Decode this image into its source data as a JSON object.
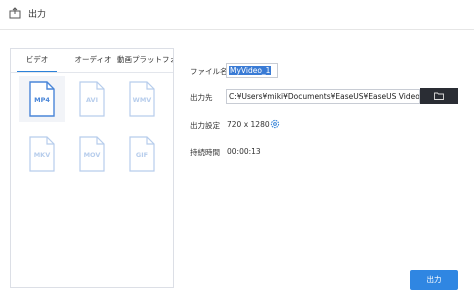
{
  "window": {
    "title": "出力"
  },
  "tabs": [
    {
      "label": "ビデオ",
      "active": true
    },
    {
      "label": "オーディオ",
      "active": false
    },
    {
      "label": "動画プラットフォーム",
      "active": false
    }
  ],
  "formats": [
    {
      "label": "MP4",
      "selected": true
    },
    {
      "label": "AVI",
      "selected": false
    },
    {
      "label": "WMV",
      "selected": false
    },
    {
      "label": "MKV",
      "selected": false
    },
    {
      "label": "MOV",
      "selected": false
    },
    {
      "label": "GIF",
      "selected": false
    }
  ],
  "settings": {
    "filename_label": "ファイル名",
    "filename_value": "MyVideo_1",
    "output_label": "出力先",
    "output_path": "C:¥Users¥miki¥Documents¥EaseUS¥EaseUS Video Editor¥C",
    "output_settings_label": "出力設定",
    "resolution": "720 x 1280",
    "duration_label": "持続時間",
    "duration": "00:00:13"
  },
  "actions": {
    "export_label": "出力"
  },
  "colors": {
    "accent": "#2f86e2",
    "format_selected": "#4a86d8",
    "format_inactive": "#b7cdec"
  }
}
